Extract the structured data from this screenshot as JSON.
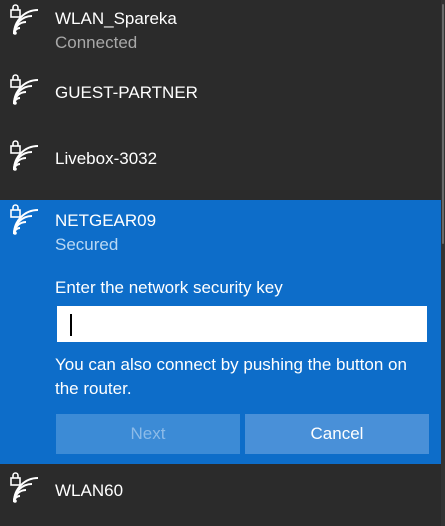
{
  "networks": [
    {
      "name": "WLAN_Spareka",
      "status": "Connected",
      "icon": "wifi-secured-icon"
    },
    {
      "name": "GUEST-PARTNER",
      "icon": "wifi-secured-icon"
    },
    {
      "name": "Livebox-3032",
      "icon": "wifi-secured-icon"
    },
    {
      "name": "NETGEAR09",
      "status": "Secured",
      "icon": "wifi-secured-icon"
    },
    {
      "name": "WLAN60",
      "icon": "wifi-secured-icon"
    }
  ],
  "connect_panel": {
    "key_label": "Enter the network security key",
    "key_value": "",
    "wps_text": "You can also connect by pushing the button on the router.",
    "next_label": "Next",
    "cancel_label": "Cancel"
  },
  "colors": {
    "background": "#2b2b2b",
    "selected": "#0d6dc9",
    "button": "#4990d8",
    "button_disabled": "#3c8bd6",
    "status_text": "#a8a8a8"
  }
}
